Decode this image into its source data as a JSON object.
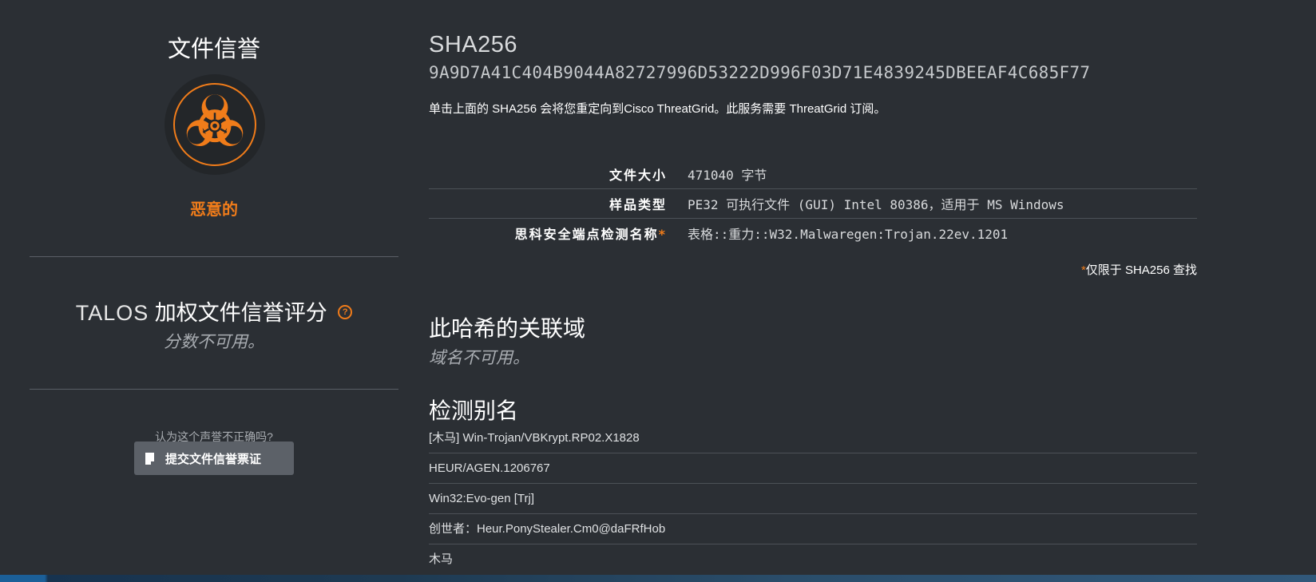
{
  "reputation": {
    "title": "文件信誉",
    "verdict": "恶意的",
    "badge_icon": "biohazard-icon",
    "accent_color": "#f07c1a"
  },
  "talos": {
    "title_prefix": "TALOS",
    "title_main": "加权文件信誉评分",
    "help_glyph": "?",
    "score_text": "分数不可用。"
  },
  "ticket": {
    "question": "认为这个声誉不正确吗?",
    "button_label": "提交文件信誉票证"
  },
  "hash": {
    "label": "SHA256",
    "value": "9A9D7A41C404B9044A82727996D53222D996F03D71E4839245DBEEAF4C685F77",
    "note": "单击上面的 SHA256 会将您重定向到Cisco ThreatGrid。此服务需要 ThreatGrid 订阅。"
  },
  "details": [
    {
      "key": "文件大小",
      "value": "471040 字节",
      "asterisk": ""
    },
    {
      "key": "样品类型",
      "value": "PE32 可执行文件 (GUI) Intel 80386，适用于 MS Windows",
      "asterisk": ""
    },
    {
      "key": "思科安全端点检测名称",
      "value": "表格::重力::W32.Malwaregen:Trojan.22ev.1201",
      "asterisk": "*"
    }
  ],
  "footnote": {
    "asterisk": "*",
    "text": "仅限于 SHA256 查找"
  },
  "domains": {
    "heading": "此哈希的关联域",
    "empty_text": "域名不可用。"
  },
  "aliases": {
    "heading": "检测别名",
    "items": [
      "[木马] Win-Trojan/VBKrypt.RP02.X1828",
      "HEUR/AGEN.1206767",
      "Win32:Evo-gen [Trj]",
      "创世者：Heur.PonyStealer.Cm0@daFRfHob",
      "木马"
    ]
  }
}
